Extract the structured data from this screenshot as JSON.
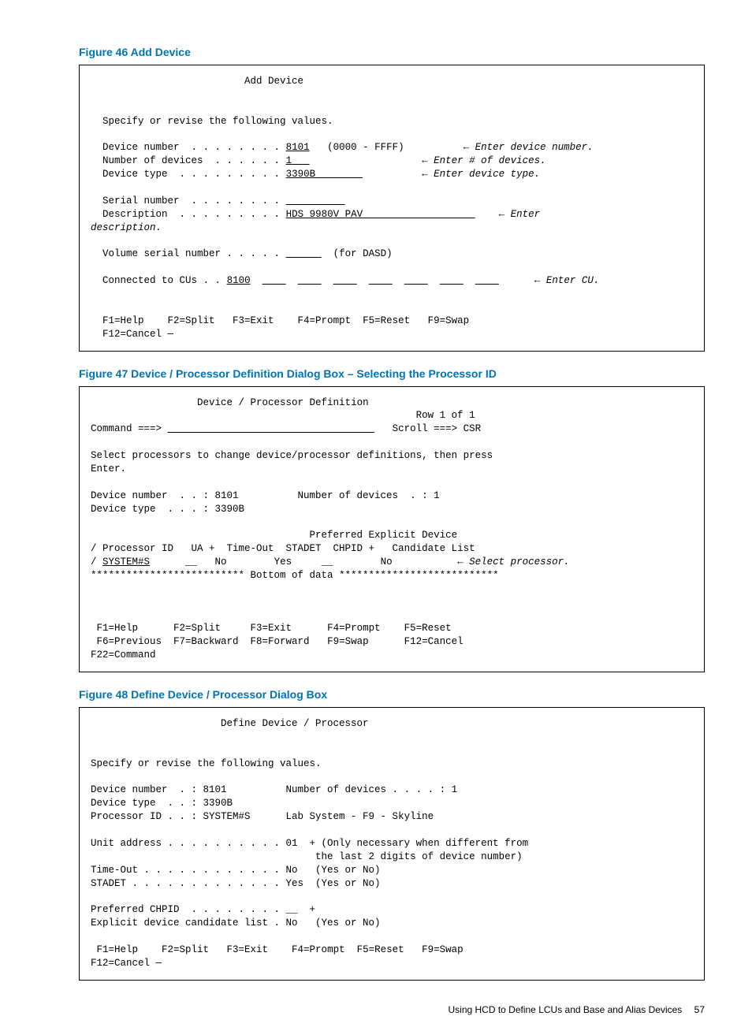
{
  "figures": {
    "46": {
      "title": "Figure 46 Add Device",
      "screen_title": "Add Device",
      "instruct": "Specify or revise the following values.",
      "device_number_label": "Device number  . . . . . . . .",
      "device_number_value": "8101",
      "device_number_range": "(0000 - FFFF)",
      "device_number_hint": "Enter device number.",
      "num_devices_label": "Number of devices  . . . . . .",
      "num_devices_value": "1",
      "num_devices_hint": "Enter # of devices.",
      "device_type_label": "Device type  . . . . . . . . .",
      "device_type_value": "3390B",
      "device_type_hint": "Enter device type.",
      "serial_label": "Serial number  . . . . . . . .",
      "serial_value": "",
      "desc_label": "Description  . . . . . . . . .",
      "desc_value": "HDS 9980V PAV",
      "desc_hint": "Enter",
      "desc_hint2": "description.",
      "vol_label": "Volume serial number . . . . .",
      "vol_value": "",
      "vol_note": "(for DASD)",
      "cu_label": "Connected to CUs . .",
      "cu_value": "8100",
      "cu_hint": "Enter CU.",
      "fkeys_line1": "F1=Help    F2=Split   F3=Exit    F4=Prompt  F5=Reset   F9=Swap",
      "fkeys_line2": "F12=Cancel —"
    },
    "47": {
      "title": "Figure 47 Device / Processor Definition Dialog Box – Selecting the Processor ID",
      "screen_title": "Device / Processor Definition",
      "row": "Row 1 of 1",
      "cmd_label": "Command ===>",
      "scroll": "Scroll ===> CSR",
      "instruct1": "Select processors to change device/processor definitions, then press",
      "instruct2": "Enter.",
      "dev_num": "Device number  . . : 8101          Number of devices  . : 1",
      "dev_type": "Device type  . . . : 3390B",
      "col_head1": "                                     Preferred Explicit Device",
      "col_head2": "/ Processor ID   UA +  Time-Out  STADET  CHPID +   Candidate List",
      "row_data_pre": "/",
      "row_sys": "SYSTEM#S",
      "row_data_post": "      __   No        Yes     __        No           ",
      "row_hint": "Select processor.",
      "bottom": "************************** Bottom of data ***************************",
      "fkeys1": "F1=Help      F2=Split     F3=Exit      F4=Prompt    F5=Reset",
      "fkeys2": "F6=Previous  F7=Backward  F8=Forward   F9=Swap      F12=Cancel",
      "fkeys3": "F22=Command"
    },
    "48": {
      "title": "Figure 48 Define Device / Processor Dialog Box",
      "screen_title": "Define Device / Processor",
      "instruct": "Specify or revise the following values.",
      "dev_num": "Device number  . : 8101          Number of devices . . . . : 1",
      "dev_type": "Device type  . . : 3390B",
      "proc_id": "Processor ID . . : SYSTEM#S      Lab System - F9 - Skyline",
      "unit_addr": "Unit address . . . . . . . . . . 01  + (Only necessary when different from",
      "unit_addr2": "                                      the last 2 digits of device number)",
      "timeout": "Time-Out . . . . . . . . . . . . No   (Yes or No)",
      "stadet": "STADET . . . . . . . . . . . . . Yes  (Yes or No)",
      "pref_chpid": "Preferred CHPID  . . . . . . . . __  +",
      "explicit": "Explicit device candidate list . No   (Yes or No)",
      "fkeys1": "F1=Help    F2=Split   F3=Exit    F4=Prompt  F5=Reset   F9=Swap",
      "fkeys2": "F12=Cancel —"
    }
  },
  "footer": {
    "text": "Using HCD to Define LCUs and Base and Alias Devices",
    "page": "57"
  }
}
